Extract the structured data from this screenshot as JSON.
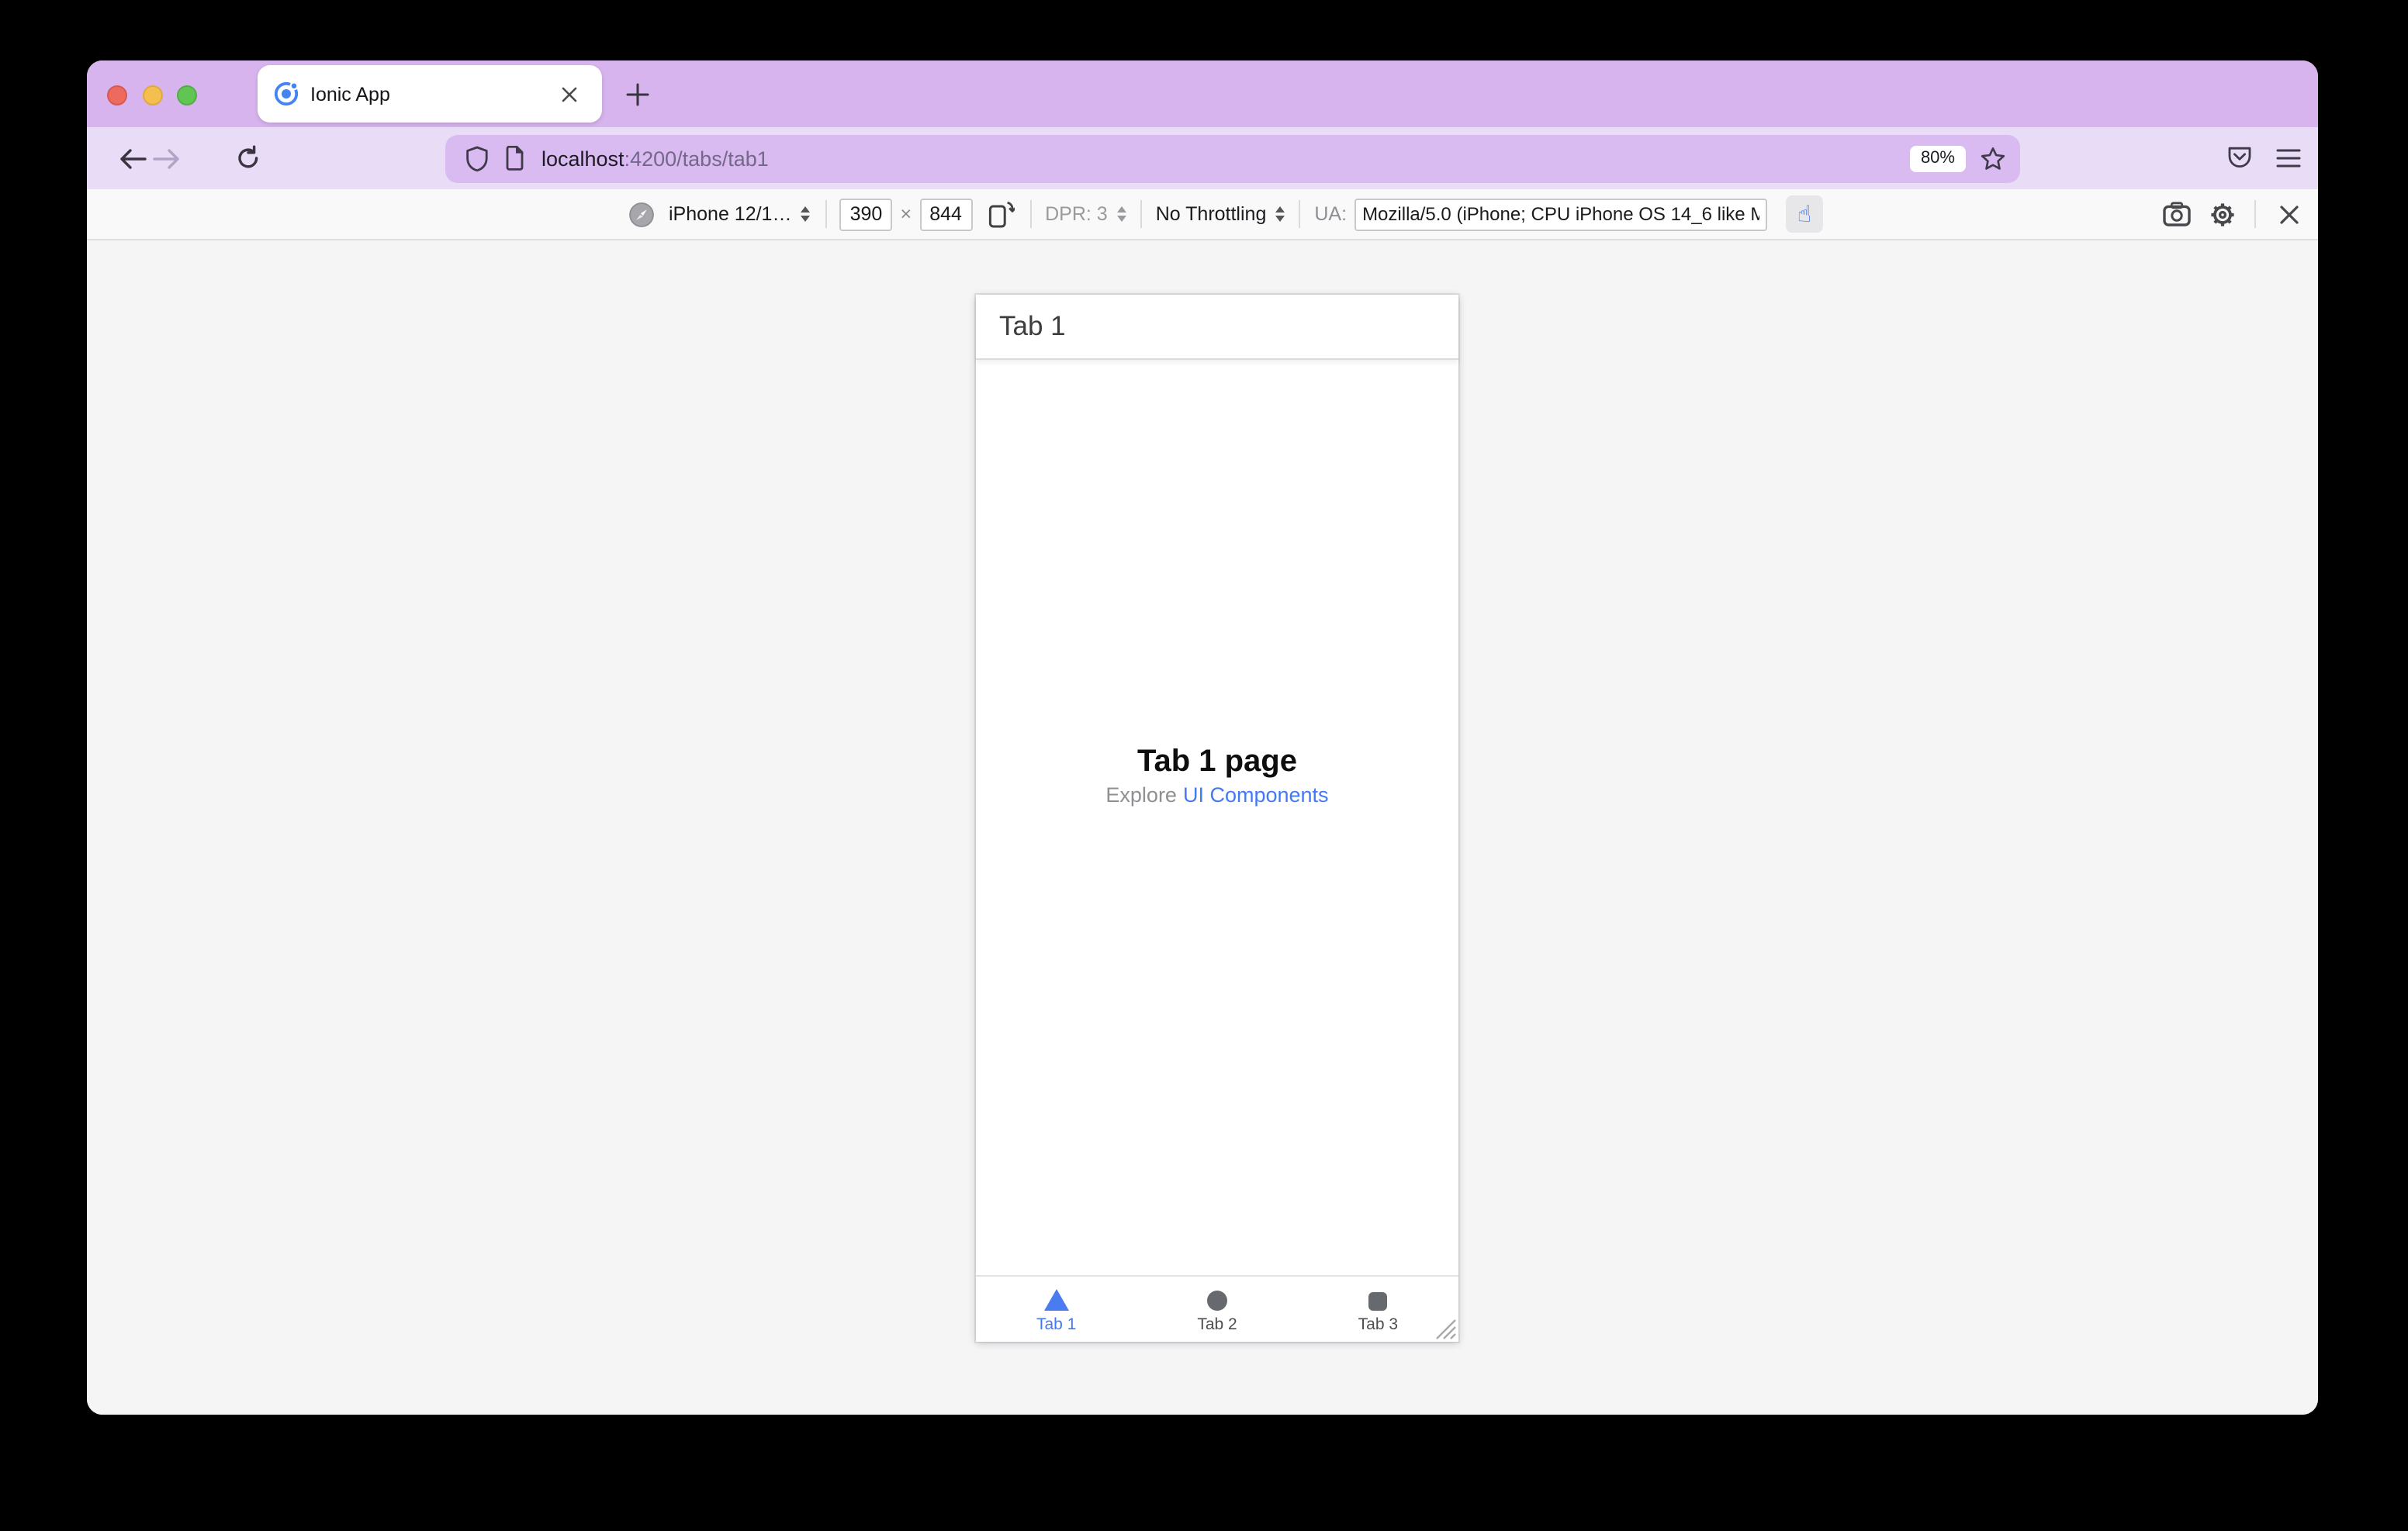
{
  "browser": {
    "tab": {
      "title": "Ionic App"
    },
    "new_tab_label": "+",
    "url": {
      "host": "localhost",
      "path": ":4200/tabs/tab1"
    },
    "zoom_badge": "80%"
  },
  "rdm": {
    "device": "iPhone 12/1…",
    "width": "390",
    "times": "×",
    "height": "844",
    "dpr": "DPR: 3",
    "throttling": "No Throttling",
    "ua_label": "UA:",
    "ua_value": "Mozilla/5.0 (iPhone; CPU iPhone OS 14_6 like M",
    "touch_glyph": "☝"
  },
  "app": {
    "header_title": "Tab 1",
    "page_title": "Tab 1 page",
    "explore_prefix": "Explore",
    "explore_link": "UI Components",
    "tabs": [
      {
        "label": "Tab 1",
        "icon": "triangle",
        "active": true
      },
      {
        "label": "Tab 2",
        "icon": "circle",
        "active": false
      },
      {
        "label": "Tab 3",
        "icon": "square",
        "active": false
      }
    ]
  },
  "colors": {
    "theme_titlebar": "#d8b4ef",
    "theme_toolbar": "#e9dcf6",
    "url_pill": "#d9baf1",
    "accent_blue": "#4a7cf0",
    "link_blue": "#4479f4",
    "traffic_red": "#ec6a5e",
    "traffic_yellow": "#f5bf4f",
    "traffic_green": "#61c554"
  }
}
